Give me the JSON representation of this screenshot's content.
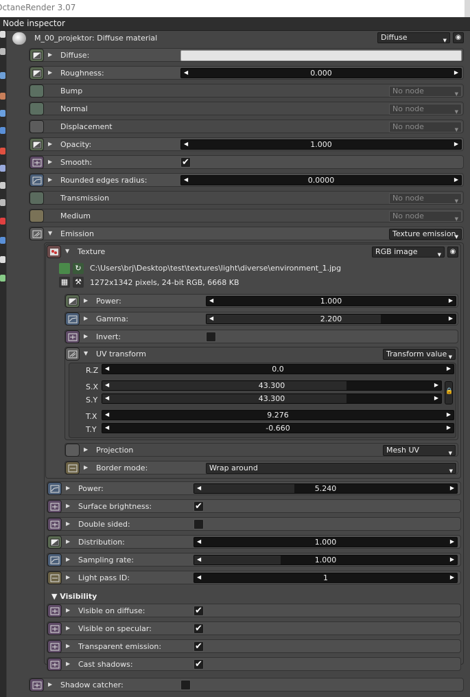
{
  "app": {
    "title": "OctaneRender 3.07"
  },
  "inspector": {
    "title": "Node inspector",
    "material": "M_00_projektor: Diffuse material",
    "material_type": "Diffuse"
  },
  "rows": {
    "diffuse": "Diffuse:",
    "roughness": "Roughness:",
    "roughness_v": "0.000",
    "bump": "Bump",
    "normal": "Normal",
    "displacement": "Displacement",
    "no_node": "No node",
    "opacity": "Opacity:",
    "opacity_v": "1.000",
    "smooth": "Smooth:",
    "rounded": "Rounded edges radius:",
    "rounded_v": "0.0000",
    "transmission": "Transmission",
    "medium": "Medium",
    "emission": "Emission",
    "emission_type": "Texture emission"
  },
  "texture": {
    "label": "Texture",
    "type": "RGB image",
    "path": "C:\\Users\\brj\\Desktop\\test\\textures\\light\\diverse\\environment_1.jpg",
    "info": "1272x1342 pixels, 24-bit RGB, 6668 KB",
    "power": "Power:",
    "power_v": "1.000",
    "gamma": "Gamma:",
    "gamma_v": "2.200",
    "invert": "Invert:",
    "uv": "UV transform",
    "uv_type": "Transform value",
    "rz": "R.Z",
    "rz_v": "0.0",
    "sx": "S.X",
    "sx_v": "43.300",
    "sy": "S.Y",
    "sy_v": "43.300",
    "tx": "T.X",
    "tx_v": "9.276",
    "ty": "T.Y",
    "ty_v": "-0.660",
    "projection": "Projection",
    "projection_v": "Mesh UV",
    "border": "Border mode:",
    "border_v": "Wrap around"
  },
  "emission": {
    "power": "Power:",
    "power_v": "5.240",
    "surface": "Surface brightness:",
    "double": "Double sided:",
    "distribution": "Distribution:",
    "distribution_v": "1.000",
    "sampling": "Sampling rate:",
    "sampling_v": "1.000",
    "lightpass": "Light pass ID:",
    "lightpass_v": "1"
  },
  "visibility": {
    "title": "▼ Visibility",
    "diffuse": "Visible on diffuse:",
    "specular": "Visible on specular:",
    "transparent": "Transparent emission:",
    "shadows": "Cast shadows:"
  },
  "shadow_catcher": "Shadow catcher:",
  "checkmark": "✔"
}
